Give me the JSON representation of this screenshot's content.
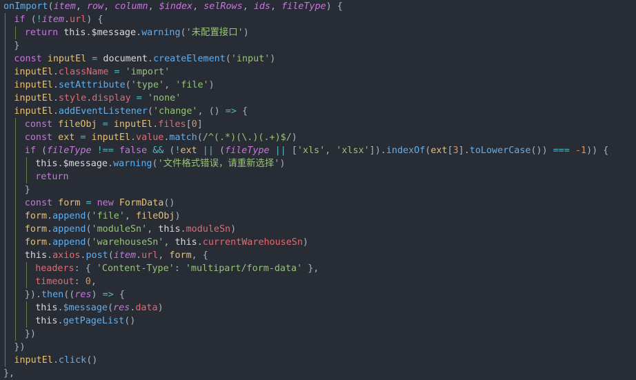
{
  "editor": {
    "background": "#282c34",
    "colors": {
      "keyword": "#c678dd",
      "function": "#61afef",
      "variable": "#e5c07b",
      "property": "#e06c75",
      "parameter": "#c678dd",
      "string": "#98c379",
      "number": "#d19a66",
      "operator": "#56b6c2",
      "plain": "#d7dae0",
      "punctuation": "#abb2bf"
    },
    "lines": [
      {
        "indent": 0,
        "tokens": [
          [
            "fn",
            "onImport"
          ],
          [
            "punc",
            "("
          ],
          [
            "param",
            "item"
          ],
          [
            "punc",
            ", "
          ],
          [
            "param",
            "row"
          ],
          [
            "punc",
            ", "
          ],
          [
            "param",
            "column"
          ],
          [
            "punc",
            ", "
          ],
          [
            "param",
            "$index"
          ],
          [
            "punc",
            ", "
          ],
          [
            "param",
            "selRows"
          ],
          [
            "punc",
            ", "
          ],
          [
            "param",
            "ids"
          ],
          [
            "punc",
            ", "
          ],
          [
            "param",
            "fileType"
          ],
          [
            "punc",
            ") {"
          ]
        ]
      },
      {
        "indent": 1,
        "tokens": [
          [
            "kw",
            "if"
          ],
          [
            "punc",
            " ("
          ],
          [
            "op",
            "!"
          ],
          [
            "param",
            "item"
          ],
          [
            "punc",
            "."
          ],
          [
            "prop",
            "url"
          ],
          [
            "punc",
            ") {"
          ]
        ]
      },
      {
        "indent": 2,
        "tokens": [
          [
            "kw",
            "return"
          ],
          [
            "plain",
            " this"
          ],
          [
            "punc",
            "."
          ],
          [
            "plain",
            "$message"
          ],
          [
            "punc",
            "."
          ],
          [
            "fn",
            "warning"
          ],
          [
            "punc",
            "("
          ],
          [
            "str",
            "'未配置接口'"
          ],
          [
            "punc",
            ")"
          ]
        ]
      },
      {
        "indent": 1,
        "tokens": [
          [
            "punc",
            "}"
          ]
        ]
      },
      {
        "indent": 1,
        "tokens": [
          [
            "kw",
            "const"
          ],
          [
            "var",
            " inputEl"
          ],
          [
            "op",
            " = "
          ],
          [
            "plain",
            "document"
          ],
          [
            "punc",
            "."
          ],
          [
            "fn",
            "createElement"
          ],
          [
            "punc",
            "("
          ],
          [
            "str",
            "'input'"
          ],
          [
            "punc",
            ")"
          ]
        ]
      },
      {
        "indent": 1,
        "tokens": [
          [
            "var",
            "inputEl"
          ],
          [
            "punc",
            "."
          ],
          [
            "prop",
            "className"
          ],
          [
            "op",
            " = "
          ],
          [
            "str",
            "'import'"
          ]
        ]
      },
      {
        "indent": 1,
        "tokens": [
          [
            "var",
            "inputEl"
          ],
          [
            "punc",
            "."
          ],
          [
            "fn",
            "setAttribute"
          ],
          [
            "punc",
            "("
          ],
          [
            "str",
            "'type'"
          ],
          [
            "punc",
            ", "
          ],
          [
            "str",
            "'file'"
          ],
          [
            "punc",
            ")"
          ]
        ]
      },
      {
        "indent": 1,
        "tokens": [
          [
            "var",
            "inputEl"
          ],
          [
            "punc",
            "."
          ],
          [
            "prop",
            "style"
          ],
          [
            "punc",
            "."
          ],
          [
            "prop",
            "display"
          ],
          [
            "op",
            " = "
          ],
          [
            "str",
            "'none'"
          ]
        ]
      },
      {
        "indent": 1,
        "tokens": [
          [
            "var",
            "inputEl"
          ],
          [
            "punc",
            "."
          ],
          [
            "fn",
            "addEventListener"
          ],
          [
            "punc",
            "("
          ],
          [
            "str",
            "'change'"
          ],
          [
            "punc",
            ", () "
          ],
          [
            "op",
            "=>"
          ],
          [
            "punc",
            " {"
          ]
        ]
      },
      {
        "indent": 2,
        "tokens": [
          [
            "kw",
            "const"
          ],
          [
            "var",
            " fileObj"
          ],
          [
            "op",
            " = "
          ],
          [
            "var",
            "inputEl"
          ],
          [
            "punc",
            "."
          ],
          [
            "prop",
            "files"
          ],
          [
            "punc",
            "["
          ],
          [
            "num",
            "0"
          ],
          [
            "punc",
            "]"
          ]
        ]
      },
      {
        "indent": 2,
        "tokens": [
          [
            "kw",
            "const"
          ],
          [
            "var",
            " ext"
          ],
          [
            "op",
            " = "
          ],
          [
            "var",
            "inputEl"
          ],
          [
            "punc",
            "."
          ],
          [
            "prop",
            "value"
          ],
          [
            "punc",
            "."
          ],
          [
            "fn",
            "match"
          ],
          [
            "punc",
            "("
          ],
          [
            "str",
            "/^(.*)(\\.)(.+)$/"
          ],
          [
            "punc",
            ")"
          ]
        ]
      },
      {
        "indent": 2,
        "tokens": [
          [
            "kw",
            "if"
          ],
          [
            "punc",
            " ("
          ],
          [
            "param",
            "fileType"
          ],
          [
            "op",
            " !== "
          ],
          [
            "kw",
            "false"
          ],
          [
            "op",
            " && "
          ],
          [
            "punc",
            "("
          ],
          [
            "op",
            "!"
          ],
          [
            "var",
            "ext"
          ],
          [
            "op",
            " || "
          ],
          [
            "punc",
            "("
          ],
          [
            "param",
            "fileType"
          ],
          [
            "op",
            " || "
          ],
          [
            "punc",
            "["
          ],
          [
            "str",
            "'xls'"
          ],
          [
            "punc",
            ", "
          ],
          [
            "str",
            "'xlsx'"
          ],
          [
            "punc",
            "])."
          ],
          [
            "fn",
            "indexOf"
          ],
          [
            "punc",
            "("
          ],
          [
            "var",
            "ext"
          ],
          [
            "punc",
            "["
          ],
          [
            "num",
            "3"
          ],
          [
            "punc",
            "]."
          ],
          [
            "fn",
            "toLowerCase"
          ],
          [
            "punc",
            "())"
          ],
          [
            "op",
            " === "
          ],
          [
            "num",
            "-1"
          ],
          [
            "punc",
            ")) {"
          ]
        ]
      },
      {
        "indent": 3,
        "tokens": [
          [
            "plain",
            "this"
          ],
          [
            "punc",
            "."
          ],
          [
            "plain",
            "$message"
          ],
          [
            "punc",
            "."
          ],
          [
            "fn",
            "warning"
          ],
          [
            "punc",
            "("
          ],
          [
            "str",
            "'文件格式错误，请重新选择'"
          ],
          [
            "punc",
            ")"
          ]
        ]
      },
      {
        "indent": 3,
        "tokens": [
          [
            "kw",
            "return"
          ]
        ]
      },
      {
        "indent": 2,
        "tokens": [
          [
            "punc",
            "}"
          ]
        ]
      },
      {
        "indent": 2,
        "tokens": [
          [
            "kw",
            "const"
          ],
          [
            "var",
            " form"
          ],
          [
            "op",
            " = "
          ],
          [
            "kw",
            "new"
          ],
          [
            "var",
            " FormData"
          ],
          [
            "punc",
            "()"
          ]
        ]
      },
      {
        "indent": 2,
        "tokens": [
          [
            "var",
            "form"
          ],
          [
            "punc",
            "."
          ],
          [
            "fn",
            "append"
          ],
          [
            "punc",
            "("
          ],
          [
            "str",
            "'file'"
          ],
          [
            "punc",
            ", "
          ],
          [
            "var",
            "fileObj"
          ],
          [
            "punc",
            ")"
          ]
        ]
      },
      {
        "indent": 2,
        "tokens": [
          [
            "var",
            "form"
          ],
          [
            "punc",
            "."
          ],
          [
            "fn",
            "append"
          ],
          [
            "punc",
            "("
          ],
          [
            "str",
            "'moduleSn'"
          ],
          [
            "punc",
            ", "
          ],
          [
            "plain",
            "this"
          ],
          [
            "punc",
            "."
          ],
          [
            "prop",
            "moduleSn"
          ],
          [
            "punc",
            ")"
          ]
        ]
      },
      {
        "indent": 2,
        "tokens": [
          [
            "var",
            "form"
          ],
          [
            "punc",
            "."
          ],
          [
            "fn",
            "append"
          ],
          [
            "punc",
            "("
          ],
          [
            "str",
            "'warehouseSn'"
          ],
          [
            "punc",
            ", "
          ],
          [
            "plain",
            "this"
          ],
          [
            "punc",
            "."
          ],
          [
            "prop",
            "currentWarehouseSn"
          ],
          [
            "punc",
            ")"
          ]
        ]
      },
      {
        "indent": 2,
        "tokens": [
          [
            "plain",
            "this"
          ],
          [
            "punc",
            "."
          ],
          [
            "prop",
            "axios"
          ],
          [
            "punc",
            "."
          ],
          [
            "fn",
            "post"
          ],
          [
            "punc",
            "("
          ],
          [
            "param",
            "item"
          ],
          [
            "punc",
            "."
          ],
          [
            "prop",
            "url"
          ],
          [
            "punc",
            ", "
          ],
          [
            "var",
            "form"
          ],
          [
            "punc",
            ", {"
          ]
        ]
      },
      {
        "indent": 3,
        "tokens": [
          [
            "prop",
            "headers"
          ],
          [
            "punc",
            ": { "
          ],
          [
            "str",
            "'Content-Type'"
          ],
          [
            "punc",
            ": "
          ],
          [
            "str",
            "'multipart/form-data'"
          ],
          [
            "punc",
            " },"
          ]
        ]
      },
      {
        "indent": 3,
        "tokens": [
          [
            "prop",
            "timeout"
          ],
          [
            "punc",
            ": "
          ],
          [
            "num",
            "0"
          ],
          [
            "punc",
            ","
          ]
        ]
      },
      {
        "indent": 2,
        "tokens": [
          [
            "punc",
            "})."
          ],
          [
            "fn",
            "then"
          ],
          [
            "punc",
            "(("
          ],
          [
            "param",
            "res"
          ],
          [
            "punc",
            ") "
          ],
          [
            "op",
            "=>"
          ],
          [
            "punc",
            " {"
          ]
        ]
      },
      {
        "indent": 3,
        "tokens": [
          [
            "plain",
            "this"
          ],
          [
            "punc",
            "."
          ],
          [
            "fn",
            "$message"
          ],
          [
            "punc",
            "("
          ],
          [
            "param",
            "res"
          ],
          [
            "punc",
            "."
          ],
          [
            "prop",
            "data"
          ],
          [
            "punc",
            ")"
          ]
        ]
      },
      {
        "indent": 3,
        "tokens": [
          [
            "plain",
            "this"
          ],
          [
            "punc",
            "."
          ],
          [
            "fn",
            "getPageList"
          ],
          [
            "punc",
            "()"
          ]
        ]
      },
      {
        "indent": 2,
        "tokens": [
          [
            "punc",
            "})"
          ]
        ]
      },
      {
        "indent": 1,
        "tokens": [
          [
            "punc",
            "})"
          ]
        ]
      },
      {
        "indent": 1,
        "tokens": [
          [
            "var",
            "inputEl"
          ],
          [
            "punc",
            "."
          ],
          [
            "fn",
            "click"
          ],
          [
            "punc",
            "()"
          ]
        ]
      },
      {
        "indent": 0,
        "tokens": [
          [
            "punc",
            "},"
          ]
        ]
      }
    ]
  }
}
